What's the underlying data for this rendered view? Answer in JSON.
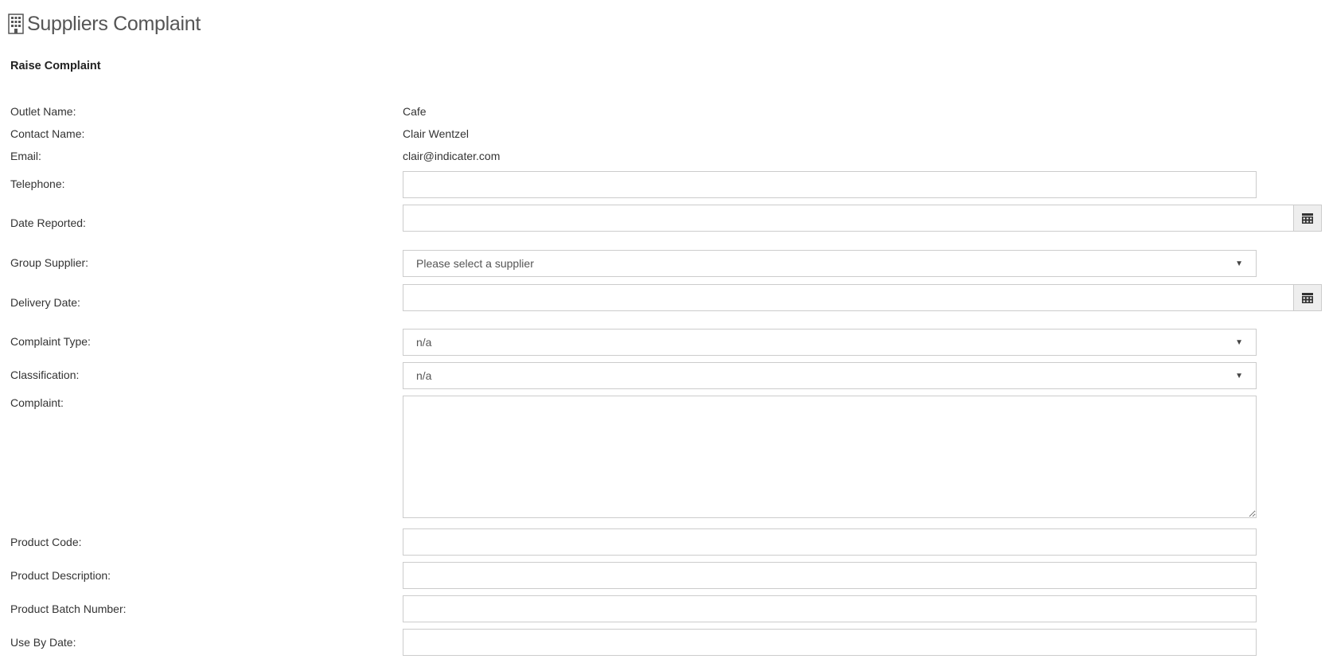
{
  "header": {
    "title": "Suppliers Complaint",
    "icon": "building-icon"
  },
  "section": {
    "title": "Raise Complaint"
  },
  "info": {
    "outlet_label": "Outlet Name:",
    "outlet_value": "Cafe",
    "contact_label": "Contact Name:",
    "contact_value": "Clair Wentzel",
    "email_label": "Email:",
    "email_value": "clair@indicater.com"
  },
  "form": {
    "telephone": {
      "label": "Telephone:",
      "value": ""
    },
    "date_reported": {
      "label": "Date Reported:",
      "value": ""
    },
    "group_supplier": {
      "label": "Group Supplier:",
      "selected": "Please select a supplier"
    },
    "delivery_date": {
      "label": "Delivery Date:",
      "value": ""
    },
    "complaint_type": {
      "label": "Complaint Type:",
      "selected": "n/a"
    },
    "classification": {
      "label": "Classification:",
      "selected": "n/a"
    },
    "complaint": {
      "label": "Complaint:",
      "value": ""
    },
    "product_code": {
      "label": "Product Code:",
      "value": ""
    },
    "product_description": {
      "label": "Product Description:",
      "value": ""
    },
    "product_batch_number": {
      "label": "Product Batch Number:",
      "value": ""
    },
    "use_by_date": {
      "label": "Use By Date:",
      "value": ""
    }
  },
  "icons": {
    "calendar": "calendar-icon",
    "caret": "caret-down-icon"
  }
}
